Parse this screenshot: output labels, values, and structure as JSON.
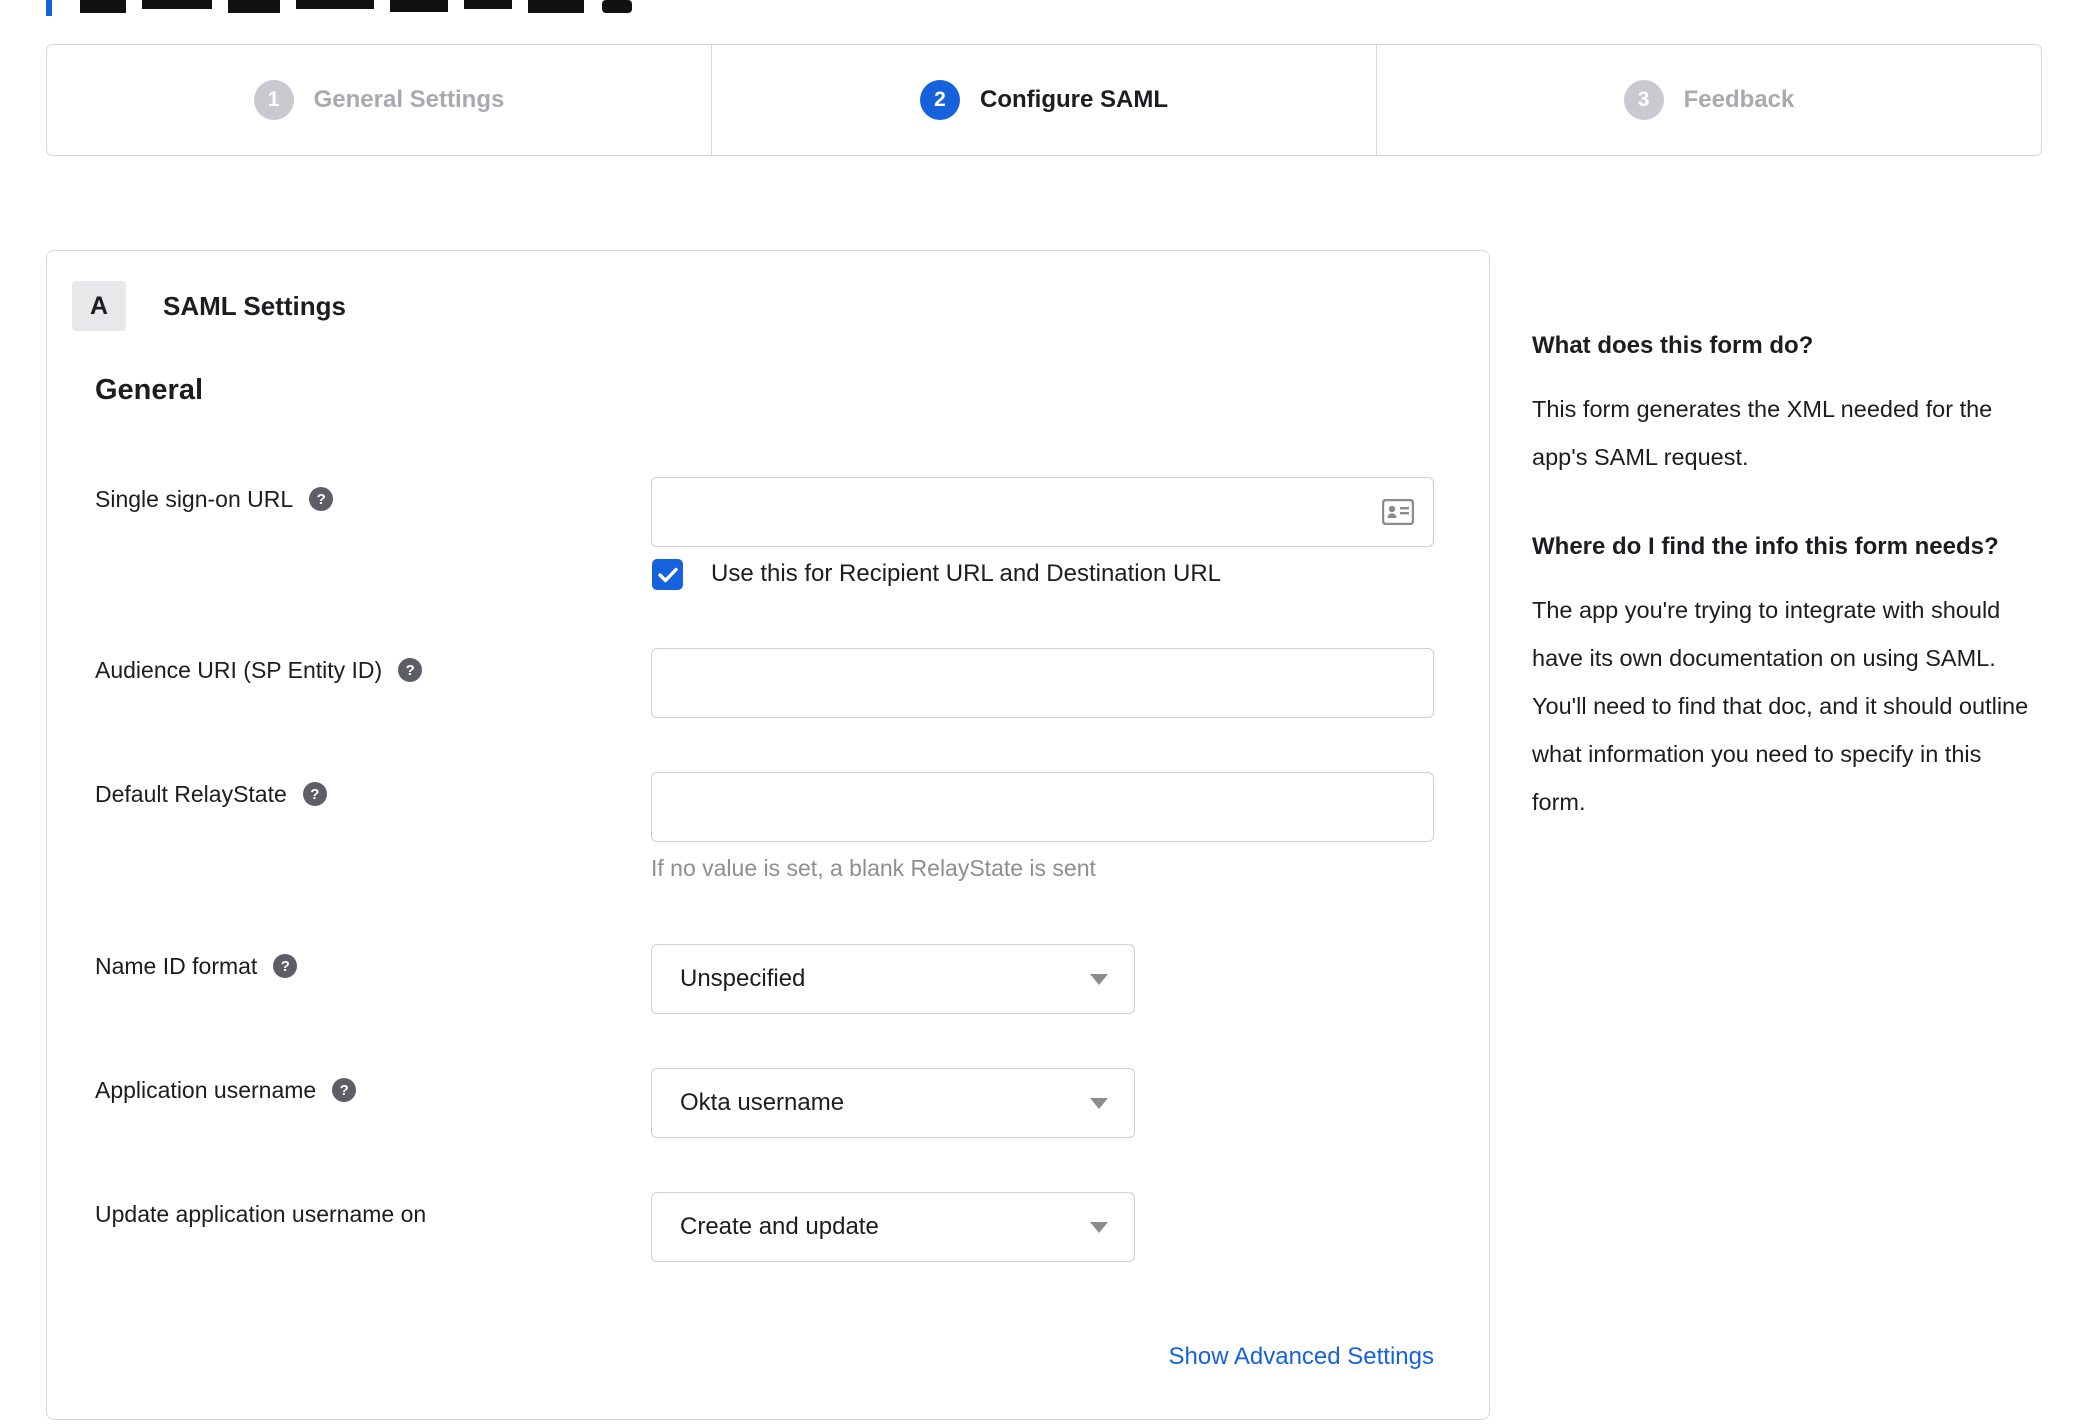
{
  "stepper": {
    "steps": [
      {
        "number": "1",
        "label": "General Settings",
        "state": "inactive"
      },
      {
        "number": "2",
        "label": "Configure SAML",
        "state": "active"
      },
      {
        "number": "3",
        "label": "Feedback",
        "state": "inactive"
      }
    ]
  },
  "panel": {
    "badge": "A",
    "title": "SAML Settings",
    "group": "General",
    "fields": {
      "sso": {
        "label": "Single sign-on URL",
        "value": ""
      },
      "sso_checkbox": {
        "label": "Use this for Recipient URL and Destination URL",
        "checked": true
      },
      "audience": {
        "label": "Audience URI (SP Entity ID)",
        "value": ""
      },
      "relaystate": {
        "label": "Default RelayState",
        "value": "",
        "help": "If no value is set, a blank RelayState is sent"
      },
      "nameid": {
        "label": "Name ID format",
        "value": "Unspecified"
      },
      "app_username": {
        "label": "Application username",
        "value": "Okta username"
      },
      "update_on": {
        "label": "Update application username on",
        "value": "Create and update"
      }
    },
    "advanced_link": "Show Advanced Settings"
  },
  "sidebar": {
    "sections": [
      {
        "heading": "What does this form do?",
        "body": "This form generates the XML needed for the app's SAML request."
      },
      {
        "heading": "Where do I find the info this form needs?",
        "body": "The app you're trying to integrate with should have its own documentation on using SAML. You'll need to find that doc, and it should outline what information you need to specify in this form."
      }
    ]
  },
  "icons": {
    "help": "?",
    "sso_field_icon": "contact-card",
    "select_caret": "dropdown-caret",
    "checkbox_check": "checkmark"
  },
  "colors": {
    "accent_blue": "#1662dd",
    "inactive_gray": "#c9c9cf",
    "border_gray": "#d8d8dc",
    "helper_gray": "#8e8e93"
  }
}
